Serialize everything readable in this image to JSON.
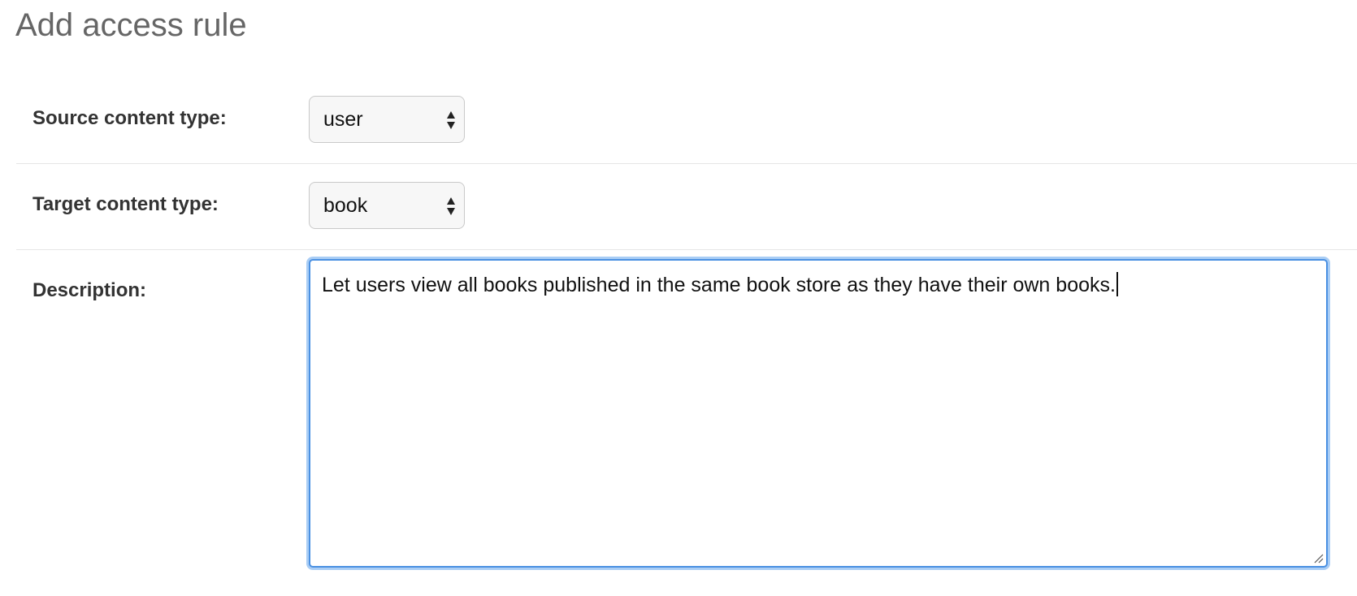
{
  "page": {
    "title": "Add access rule"
  },
  "form": {
    "source_content_type": {
      "label": "Source content type:",
      "value": "user"
    },
    "target_content_type": {
      "label": "Target content type:",
      "value": "book"
    },
    "description": {
      "label": "Description:",
      "value": "Let users view all books published in the same book store as they have their own books."
    }
  },
  "icons": {
    "select_arrows": "up-down-arrows-icon",
    "resize_handle": "resize-grip-icon"
  },
  "colors": {
    "focus_border": "#4a90e2",
    "focus_glow": "#a9cdf5",
    "title": "#666666",
    "label": "#333333"
  }
}
